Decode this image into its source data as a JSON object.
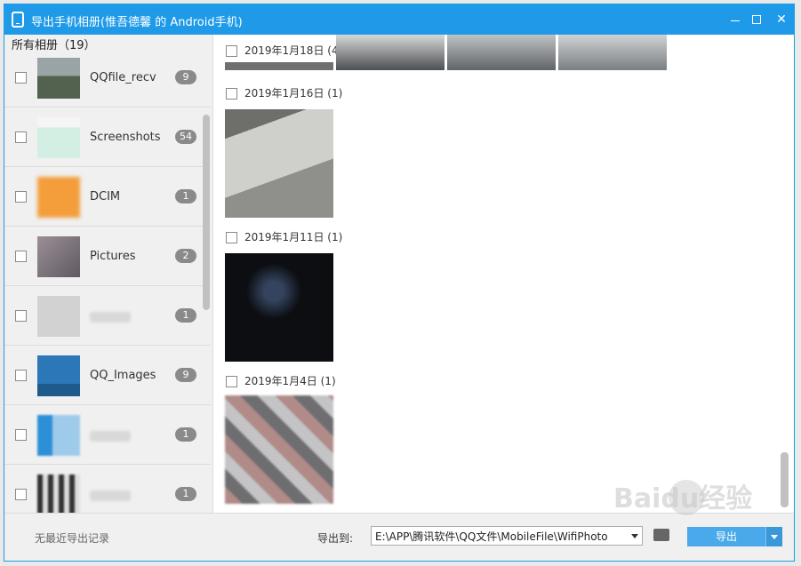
{
  "window": {
    "title": "导出手机相册(惟吾德馨 的 Android手机)",
    "accent_color": "#1e9ae8"
  },
  "sidebar": {
    "header": "所有相册（19）",
    "albums": [
      {
        "name": "QQfile_recv",
        "count": "9",
        "thumb_color": "#6f7a66"
      },
      {
        "name": "Screenshots",
        "count": "54",
        "thumb_color": "#d9ede6"
      },
      {
        "name": "DCIM",
        "count": "1",
        "thumb_color": "#f39d3b"
      },
      {
        "name": "Pictures",
        "count": "2",
        "thumb_color": "#7a6f76"
      },
      {
        "name": "",
        "count": "1",
        "thumb_color": "#cfcfcf"
      },
      {
        "name": "QQ_Images",
        "count": "9",
        "thumb_color": "#2b77b7"
      },
      {
        "name": "",
        "count": "1",
        "thumb_color": "#5aa2d8"
      },
      {
        "name": "",
        "count": "1",
        "thumb_color": "#6a6a6a"
      }
    ]
  },
  "groups": [
    {
      "date": "2019年1月18日 (4)",
      "photo_colors": [
        "#8b8f94",
        "#7d8187",
        "#9ea3a8",
        "#a7abb0"
      ]
    },
    {
      "date": "2019年1月16日 (1)",
      "photo_colors": [
        "#a9aaa8"
      ]
    },
    {
      "date": "2019年1月11日 (1)",
      "photo_colors": [
        "#111318"
      ]
    },
    {
      "date": "2019年1月4日 (1)",
      "photo_colors": [
        "#8a8c8e"
      ]
    }
  ],
  "footer": {
    "no_record": "无最近导出记录",
    "export_to_label": "导出到:",
    "path": "E:\\APP\\腾讯软件\\QQ文件\\MobileFile\\WifiPhoto",
    "export_button": "导出"
  },
  "watermark": "Baidu经验"
}
